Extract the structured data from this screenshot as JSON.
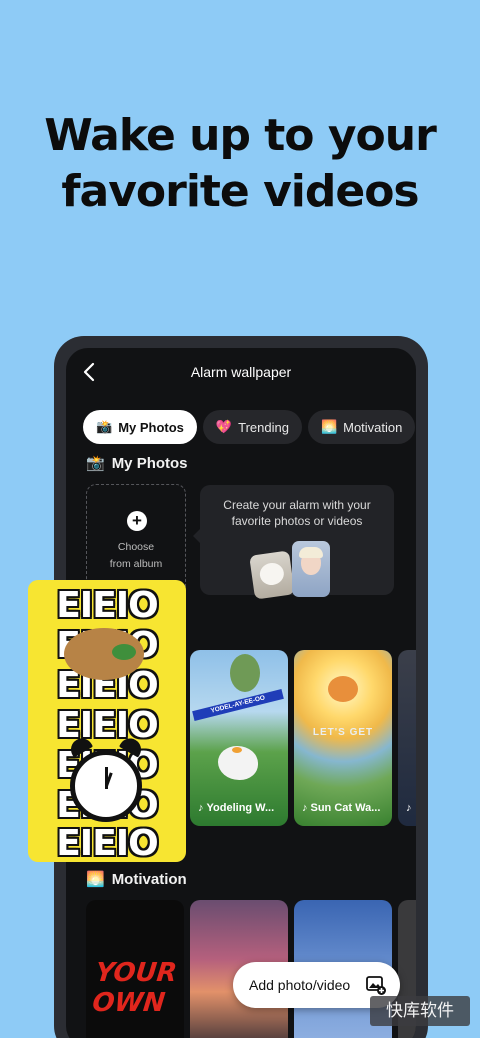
{
  "headline": {
    "line1": "Wake up to your",
    "line2": "favorite videos"
  },
  "topbar": {
    "title": "Alarm wallpaper"
  },
  "tabs": [
    {
      "label": "My Photos",
      "icon": "camera-flash-icon"
    },
    {
      "label": "Trending",
      "icon": "sparkling-heart-icon"
    },
    {
      "label": "Motivation",
      "icon": "sunrise-icon"
    }
  ],
  "sections": {
    "my_photos": "My Photos",
    "motivation": "Motivation"
  },
  "choose": {
    "label_line1": "Choose",
    "label_line2": "from album"
  },
  "promo": {
    "text": "Create your alarm with your favorite photos or videos"
  },
  "trending_cards": [
    {
      "label": "Yodeling W...",
      "banner": "YODEL-AY-EE-OO"
    },
    {
      "label": "Sun Cat Wa...",
      "overlay": "LET'S GET"
    }
  ],
  "overlay": {
    "text": "EIEIO"
  },
  "motivation_cards": [
    {
      "text_line1": "YOUR",
      "text_line2": "OWN"
    }
  ],
  "add_button": {
    "label": "Add photo/video"
  },
  "watermark": {
    "text": "快库软件"
  },
  "colors": {
    "background": "#8ecbf6",
    "screen": "#111214",
    "overlay": "#f7e531"
  }
}
